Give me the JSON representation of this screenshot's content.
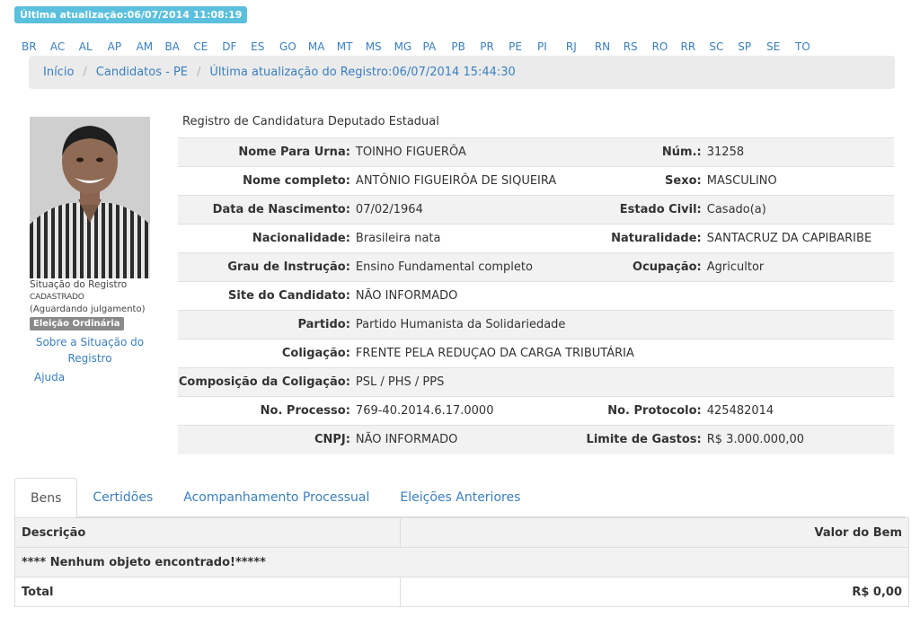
{
  "update_badge": "Última atualização:06/07/2014 11:08:19",
  "states": [
    "BR",
    "AC",
    "AL",
    "AP",
    "AM",
    "BA",
    "CE",
    "DF",
    "ES",
    "GO",
    "MA",
    "MT",
    "MS",
    "MG",
    "PA",
    "PB",
    "PR",
    "PE",
    "PI",
    "RJ",
    "RN",
    "RS",
    "RO",
    "RR",
    "SC",
    "SP",
    "SE",
    "TO"
  ],
  "breadcrumb": {
    "home": "Início",
    "candidates": "Candidatos - PE",
    "last_update": "Última atualização do Registro:06/07/2014 15:44:30"
  },
  "sidebar": {
    "status_title": "Situação do Registro",
    "status": "CADASTRADO",
    "status_detail": "(Aguardando julgamento)",
    "election_label": "Eleição Ordinária",
    "about_link": "Sobre a Situação do Registro",
    "help_link": "Ajuda"
  },
  "registration_title": "Registro de Candidatura Deputado Estadual",
  "fields": {
    "ballot_name": {
      "label": "Nome Para Urna:",
      "value": "TOINHO FIGUERÔA"
    },
    "number": {
      "label": "Núm.:",
      "value": "31258"
    },
    "full_name": {
      "label": "Nome completo:",
      "value": "ANTÔNIO FIGUEIRÔA DE SIQUEIRA"
    },
    "sex": {
      "label": "Sexo:",
      "value": "MASCULINO"
    },
    "birth_date": {
      "label": "Data de Nascimento:",
      "value": "07/02/1964"
    },
    "marital_status": {
      "label": "Estado Civil:",
      "value": "Casado(a)"
    },
    "nationality": {
      "label": "Nacionalidade:",
      "value": "Brasileira nata"
    },
    "birthplace": {
      "label": "Naturalidade:",
      "value": "SANTACRUZ DA CAPIBARIBE"
    },
    "education": {
      "label": "Grau de Instrução:",
      "value": "Ensino Fundamental completo"
    },
    "occupation": {
      "label": "Ocupação:",
      "value": "Agricultor"
    },
    "website": {
      "label": "Site do Candidato:",
      "value": "NÃO INFORMADO"
    },
    "party": {
      "label": "Partido:",
      "value": "Partido Humanista da Solidariedade"
    },
    "coalition": {
      "label": "Coligação:",
      "value": "FRENTE PELA REDUÇAO DA CARGA TRIBUTÁRIA"
    },
    "coalition_composition": {
      "label": "Composição da Coligação:",
      "value": "PSL / PHS / PPS"
    },
    "process_number": {
      "label": "No. Processo:",
      "value": "769-40.2014.6.17.0000"
    },
    "protocol_number": {
      "label": "No. Protocolo:",
      "value": "425482014"
    },
    "cnpj": {
      "label": "CNPJ:",
      "value": "NÃO INFORMADO"
    },
    "spending_limit": {
      "label": "Limite de Gastos:",
      "value": "R$ 3.000.000,00"
    }
  },
  "tabs": [
    {
      "label": "Bens"
    },
    {
      "label": "Certidões"
    },
    {
      "label": "Acompanhamento Processual"
    },
    {
      "label": "Eleições Anteriores"
    }
  ],
  "assets_table": {
    "col_description": "Descrição",
    "col_value": "Valor do Bem",
    "empty_message": "**** Nenhum objeto encontrado!*****",
    "total_label": "Total",
    "total_value": "R$ 0,00"
  }
}
